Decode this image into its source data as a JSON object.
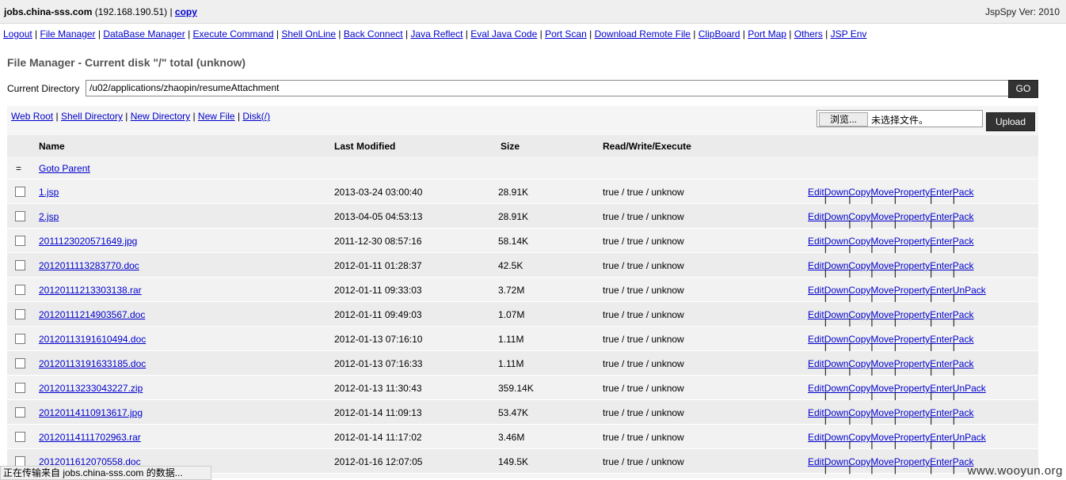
{
  "header": {
    "host": "jobs.china-sss.com",
    "ip": "(192.168.190.51) |",
    "copy_label": "copy",
    "version": "JspSpy Ver: 2010"
  },
  "menu": [
    "Logout",
    "File Manager",
    "DataBase Manager",
    "Execute Command",
    "Shell OnLine",
    "Back Connect",
    "Java Reflect",
    "Eval Java Code",
    "Port Scan",
    "Download Remote File",
    "ClipBoard",
    "Port Map",
    "Others",
    "JSP Env"
  ],
  "file_manager": {
    "title": "File Manager - Current disk \"/\" total (unknow)",
    "current_dir_label": "Current Directory",
    "current_dir": "/u02/applications/zhaopin/resumeAttachment",
    "go_label": "GO",
    "links": [
      "Web Root",
      "Shell Directory",
      "New Directory",
      "New File",
      "Disk(/)"
    ],
    "browse_label": "浏览...",
    "no_file_label": "未选择文件。",
    "upload_label": "Upload",
    "columns": {
      "name": "Name",
      "modified": "Last Modified",
      "size": "Size",
      "rwx": "Read/Write/Execute"
    },
    "parent_marker": "=",
    "goto_parent": "Goto Parent",
    "action_labels": [
      "Edit",
      "Down",
      "Copy",
      "Move",
      "Property",
      "Enter"
    ],
    "files": [
      {
        "name": "1.jsp",
        "modified": "2013-03-24 03:00:40",
        "size": "28.91K",
        "rwx": "true / true / unknow",
        "last_action": "Pack"
      },
      {
        "name": "2.jsp",
        "modified": "2013-04-05 04:53:13",
        "size": "28.91K",
        "rwx": "true / true / unknow",
        "last_action": "Pack"
      },
      {
        "name": "2011123020571649.jpg",
        "modified": "2011-12-30 08:57:16",
        "size": "58.14K",
        "rwx": "true / true / unknow",
        "last_action": "Pack"
      },
      {
        "name": "2012011113283770.doc",
        "modified": "2012-01-11 01:28:37",
        "size": "42.5K",
        "rwx": "true / true / unknow",
        "last_action": "Pack"
      },
      {
        "name": "20120111213303138.rar",
        "modified": "2012-01-11 09:33:03",
        "size": "3.72M",
        "rwx": "true / true / unknow",
        "last_action": "UnPack"
      },
      {
        "name": "20120111214903567.doc",
        "modified": "2012-01-11 09:49:03",
        "size": "1.07M",
        "rwx": "true / true / unknow",
        "last_action": "Pack"
      },
      {
        "name": "20120113191610494.doc",
        "modified": "2012-01-13 07:16:10",
        "size": "1.11M",
        "rwx": "true / true / unknow",
        "last_action": "Pack"
      },
      {
        "name": "20120113191633185.doc",
        "modified": "2012-01-13 07:16:33",
        "size": "1.11M",
        "rwx": "true / true / unknow",
        "last_action": "Pack"
      },
      {
        "name": "20120113233043227.zip",
        "modified": "2012-01-13 11:30:43",
        "size": "359.14K",
        "rwx": "true / true / unknow",
        "last_action": "UnPack"
      },
      {
        "name": "20120114110913617.jpg",
        "modified": "2012-01-14 11:09:13",
        "size": "53.47K",
        "rwx": "true / true / unknow",
        "last_action": "Pack"
      },
      {
        "name": "20120114111702963.rar",
        "modified": "2012-01-14 11:17:02",
        "size": "3.46M",
        "rwx": "true / true / unknow",
        "last_action": "UnPack"
      },
      {
        "name": "2012011612070558.doc",
        "modified": "2012-01-16 12:07:05",
        "size": "149.5K",
        "rwx": "true / true / unknow",
        "last_action": "Pack"
      }
    ]
  },
  "status_text": "正在传输来自 jobs.china-sss.com 的数据...",
  "watermark": "www.wooyun.org"
}
